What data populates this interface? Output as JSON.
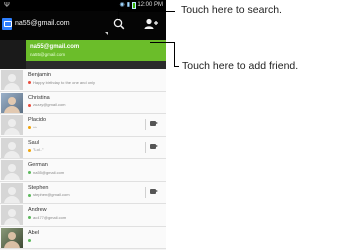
{
  "status_bar": {
    "left": "Ψ",
    "time": "12:00 PM"
  },
  "action_bar": {
    "account": "na55@gmail.com"
  },
  "me": {
    "name": "na55@gmail.com",
    "sub": "na55@gmail.com"
  },
  "contacts": [
    {
      "name": "Benjamin",
      "status": "Happy birthday to the one and only",
      "dot": "#e84c3d",
      "avatar": "blank",
      "cam": false
    },
    {
      "name": "Christina",
      "status": "zuzzy@gmail.com",
      "dot": "#e84c3d",
      "avatar": "photo",
      "cam": false
    },
    {
      "name": "Placido",
      "status": "^^",
      "dot": "#f0a30a",
      "avatar": "blank",
      "cam": true
    },
    {
      "name": "Saul",
      "status": "\"Lol..\"",
      "dot": "#f0a30a",
      "avatar": "blank",
      "cam": true
    },
    {
      "name": "German",
      "status": "na55@gmail.com",
      "dot": "#5cb85c",
      "avatar": "blank",
      "cam": false
    },
    {
      "name": "Stephen",
      "status": "stephen@gmail.com",
      "dot": "#5cb85c",
      "avatar": "blank",
      "cam": true
    },
    {
      "name": "Andrew",
      "status": "ac477@gmail.com",
      "dot": "#5cb85c",
      "avatar": "blank",
      "cam": false
    },
    {
      "name": "Abel",
      "status": "",
      "dot": "#5cb85c",
      "avatar": "photo2",
      "cam": false
    }
  ],
  "callouts": {
    "search": "Touch here to search.",
    "add_friend": "Touch here to add friend."
  },
  "icons": {
    "search": "search-icon",
    "add": "add-friend-icon",
    "app": "talk-app-icon"
  }
}
